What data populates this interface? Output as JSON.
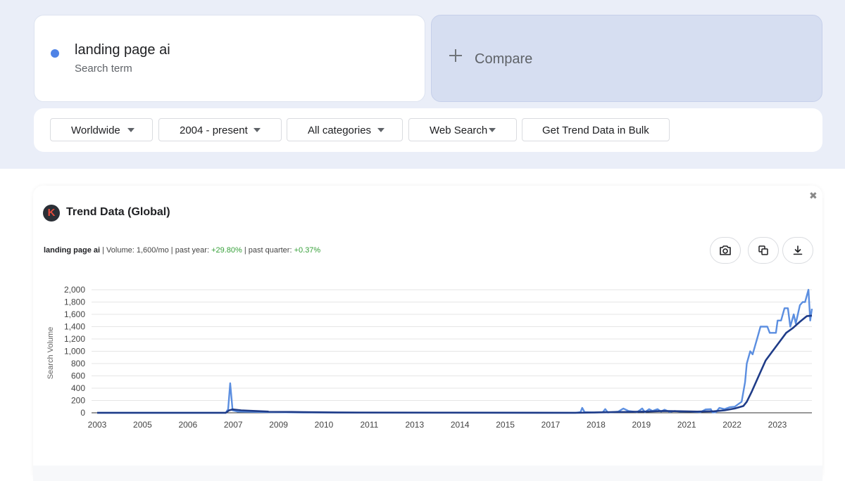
{
  "search": {
    "term": "landing page ai",
    "term_type": "Search term",
    "dot_color": "#4f83e6",
    "compare_label": "Compare"
  },
  "filters": {
    "region": "Worldwide",
    "time": "2004 - present",
    "category": "All categories",
    "type": "Web Search",
    "bulk": "Get Trend Data in Bulk"
  },
  "panel": {
    "title": "Trend Data (Global)",
    "logo_letter": "K",
    "close": "✖",
    "term": "landing page ai",
    "sep1": " | Volume: ",
    "volume": "1,600/mo",
    "sep2": " | past year: ",
    "past_year": "+29.80%",
    "sep3": " | past quarter: ",
    "past_quarter": "+0.37%",
    "actions": [
      "camera-icon",
      "copy-icon",
      "download-icon"
    ]
  },
  "chart_data": {
    "type": "line",
    "ylabel": "Search Volume",
    "ylim": [
      0,
      2000
    ],
    "yticks": [
      0,
      200,
      400,
      600,
      800,
      1000,
      1200,
      1400,
      1600,
      1800,
      2000
    ],
    "ytick_labels": [
      "0",
      "200",
      "400",
      "600",
      "800",
      "1,000",
      "1,200",
      "1,400",
      "1,600",
      "1,800",
      "2,000"
    ],
    "xlim": [
      2003,
      2023.85
    ],
    "xtick_labels": [
      "2003",
      "2005",
      "2006",
      "2007",
      "2009",
      "2010",
      "2011",
      "2013",
      "2014",
      "2015",
      "2017",
      "2018",
      "2019",
      "2021",
      "2022",
      "2023"
    ],
    "grid": true,
    "series": [
      {
        "color": "#5b8ee0",
        "points": [
          [
            2003.0,
            0
          ],
          [
            2006.75,
            0
          ],
          [
            2006.82,
            60
          ],
          [
            2006.88,
            480
          ],
          [
            2006.95,
            40
          ],
          [
            2007.1,
            20
          ],
          [
            2008,
            10
          ],
          [
            2009,
            5
          ],
          [
            2009.5,
            5
          ],
          [
            2013,
            2
          ],
          [
            2016.95,
            0
          ],
          [
            2017.1,
            10
          ],
          [
            2017.15,
            80
          ],
          [
            2017.22,
            10
          ],
          [
            2017.5,
            5
          ],
          [
            2017.75,
            10
          ],
          [
            2017.82,
            60
          ],
          [
            2017.9,
            5
          ],
          [
            2018.2,
            20
          ],
          [
            2018.35,
            70
          ],
          [
            2018.5,
            30
          ],
          [
            2018.75,
            10
          ],
          [
            2018.9,
            70
          ],
          [
            2018.98,
            10
          ],
          [
            2019.1,
            60
          ],
          [
            2019.2,
            30
          ],
          [
            2019.35,
            60
          ],
          [
            2019.45,
            20
          ],
          [
            2019.55,
            50
          ],
          [
            2019.7,
            15
          ],
          [
            2019.85,
            30
          ],
          [
            2020.0,
            20
          ],
          [
            2020.3,
            20
          ],
          [
            2020.6,
            10
          ],
          [
            2020.75,
            55
          ],
          [
            2020.9,
            60
          ],
          [
            2020.95,
            5
          ],
          [
            2021.05,
            10
          ],
          [
            2021.15,
            80
          ],
          [
            2021.3,
            60
          ],
          [
            2021.45,
            90
          ],
          [
            2021.6,
            100
          ],
          [
            2021.7,
            140
          ],
          [
            2021.8,
            180
          ],
          [
            2021.9,
            500
          ],
          [
            2021.95,
            800
          ],
          [
            2022.05,
            1000
          ],
          [
            2022.12,
            950
          ],
          [
            2022.25,
            1200
          ],
          [
            2022.35,
            1400
          ],
          [
            2022.55,
            1400
          ],
          [
            2022.62,
            1300
          ],
          [
            2022.8,
            1300
          ],
          [
            2022.85,
            1500
          ],
          [
            2022.95,
            1500
          ],
          [
            2023.05,
            1700
          ],
          [
            2023.15,
            1700
          ],
          [
            2023.22,
            1400
          ],
          [
            2023.32,
            1600
          ],
          [
            2023.38,
            1450
          ],
          [
            2023.5,
            1750
          ],
          [
            2023.58,
            1800
          ],
          [
            2023.65,
            1800
          ],
          [
            2023.75,
            2000
          ],
          [
            2023.8,
            1500
          ],
          [
            2023.85,
            1690
          ]
        ]
      },
      {
        "color": "#1f3c88",
        "points": [
          [
            2003.0,
            0
          ],
          [
            2006.75,
            0
          ],
          [
            2006.85,
            40
          ],
          [
            2006.95,
            55
          ],
          [
            2007.2,
            40
          ],
          [
            2007.6,
            30
          ],
          [
            2008,
            20
          ],
          [
            2009,
            10
          ],
          [
            2010,
            5
          ],
          [
            2013,
            2
          ],
          [
            2017.0,
            0
          ],
          [
            2017.5,
            5
          ],
          [
            2018,
            10
          ],
          [
            2018.5,
            15
          ],
          [
            2019,
            20
          ],
          [
            2019.5,
            30
          ],
          [
            2020,
            25
          ],
          [
            2020.5,
            20
          ],
          [
            2021,
            25
          ],
          [
            2021.3,
            40
          ],
          [
            2021.6,
            70
          ],
          [
            2021.85,
            110
          ],
          [
            2021.95,
            180
          ],
          [
            2022.1,
            350
          ],
          [
            2022.3,
            600
          ],
          [
            2022.5,
            850
          ],
          [
            2022.7,
            1000
          ],
          [
            2022.9,
            1150
          ],
          [
            2023.1,
            1300
          ],
          [
            2023.3,
            1380
          ],
          [
            2023.5,
            1480
          ],
          [
            2023.7,
            1570
          ],
          [
            2023.85,
            1580
          ]
        ]
      }
    ]
  }
}
